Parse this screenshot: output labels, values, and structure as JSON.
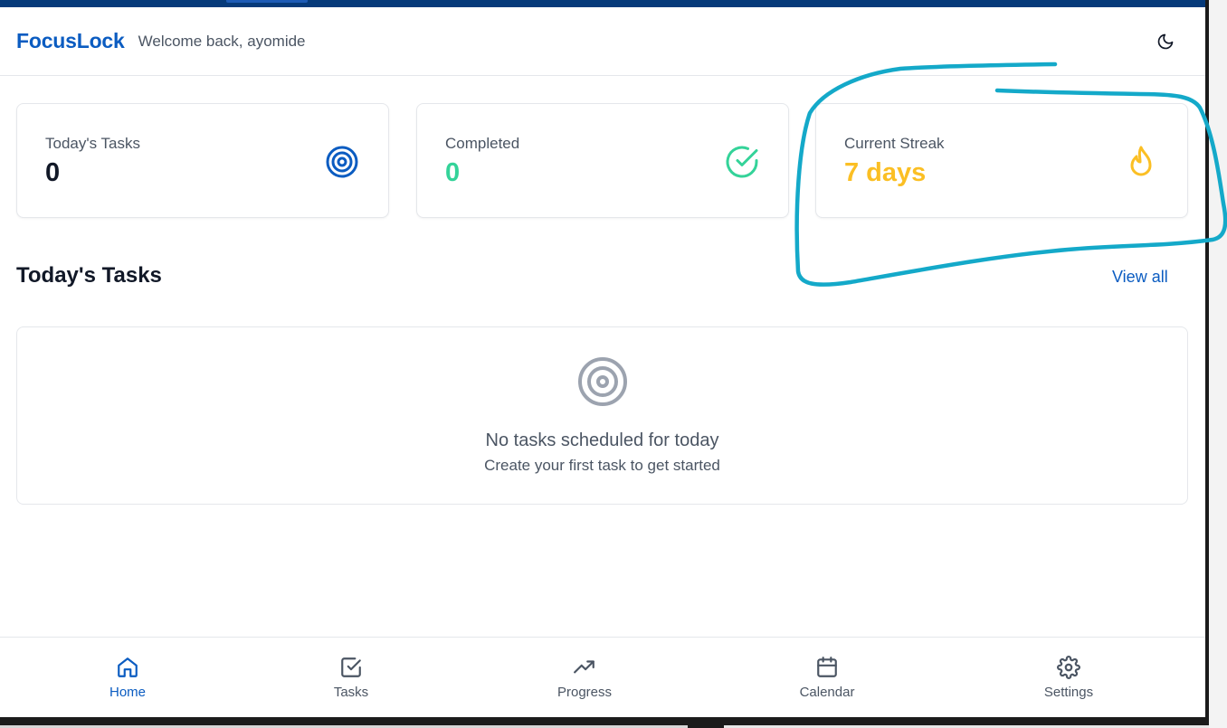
{
  "header": {
    "brand": "FocusLock",
    "welcome": "Welcome back, ayomide",
    "theme_icon": "moon-icon"
  },
  "stats": [
    {
      "label": "Today's Tasks",
      "value": "0",
      "icon": "target-icon",
      "color": "#0b5cc1"
    },
    {
      "label": "Completed",
      "value": "0",
      "icon": "check-circle-icon",
      "color": "#34d399"
    },
    {
      "label": "Current Streak",
      "value": "7 days",
      "icon": "flame-icon",
      "color": "#fbbf24"
    }
  ],
  "tasks_section": {
    "title": "Today's Tasks",
    "view_all": "View all",
    "empty_icon": "target-icon",
    "empty_title": "No tasks scheduled for today",
    "empty_subtitle": "Create your first task to get started"
  },
  "nav": [
    {
      "label": "Home",
      "icon": "home-icon",
      "active": true
    },
    {
      "label": "Tasks",
      "icon": "checkbox-icon",
      "active": false
    },
    {
      "label": "Progress",
      "icon": "trending-up-icon",
      "active": false
    },
    {
      "label": "Calendar",
      "icon": "calendar-icon",
      "active": false
    },
    {
      "label": "Settings",
      "icon": "gear-icon",
      "active": false
    }
  ],
  "colors": {
    "brand": "#0b5cc1",
    "topbar": "#063a7a",
    "completed": "#34d399",
    "streak": "#fbbf24",
    "annotation": "#14a9c9"
  },
  "annotation": {
    "type": "freehand-circle",
    "target": "Current Streak card"
  }
}
